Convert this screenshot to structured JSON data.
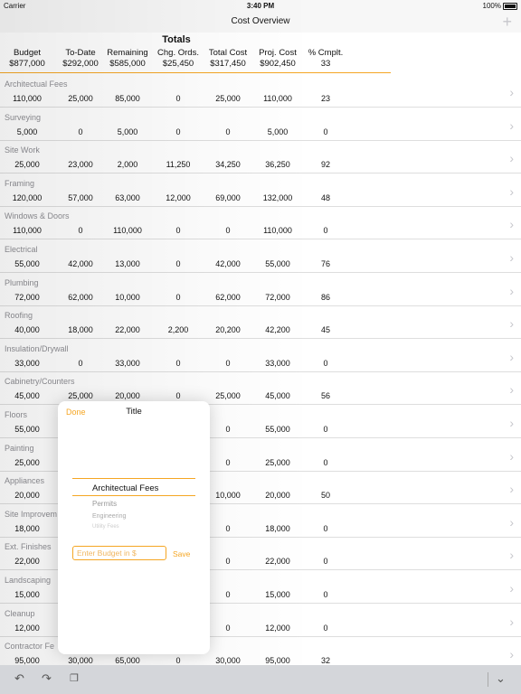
{
  "status_bar": {
    "carrier": "Carrier",
    "time": "3:40 PM",
    "battery": "100%"
  },
  "nav": {
    "title": "Cost Overview"
  },
  "totals": {
    "title": "Totals",
    "columns": [
      {
        "label": "Budget",
        "value": "$877,000"
      },
      {
        "label": "To-Date",
        "value": "$292,000"
      },
      {
        "label": "Remaining",
        "value": "$585,000"
      },
      {
        "label": "Chg. Ords.",
        "value": "$25,450"
      },
      {
        "label": "Total Cost",
        "value": "$317,450"
      },
      {
        "label": "Proj. Cost",
        "value": "$902,450"
      },
      {
        "label": "% Cmplt.",
        "value": "33"
      }
    ]
  },
  "rows": [
    {
      "label": "Architectual  Fees",
      "values": [
        "110,000",
        "25,000",
        "85,000",
        "0",
        "25,000",
        "110,000",
        "23"
      ]
    },
    {
      "label": "Surveying",
      "values": [
        "5,000",
        "0",
        "5,000",
        "0",
        "0",
        "5,000",
        "0"
      ]
    },
    {
      "label": "Site Work",
      "values": [
        "25,000",
        "23,000",
        "2,000",
        "11,250",
        "34,250",
        "36,250",
        "92"
      ]
    },
    {
      "label": "Framing",
      "values": [
        "120,000",
        "57,000",
        "63,000",
        "12,000",
        "69,000",
        "132,000",
        "48"
      ]
    },
    {
      "label": "Windows & Doors",
      "values": [
        "110,000",
        "0",
        "110,000",
        "0",
        "0",
        "110,000",
        "0"
      ]
    },
    {
      "label": "Electrical",
      "values": [
        "55,000",
        "42,000",
        "13,000",
        "0",
        "42,000",
        "55,000",
        "76"
      ]
    },
    {
      "label": "Plumbing",
      "values": [
        "72,000",
        "62,000",
        "10,000",
        "0",
        "62,000",
        "72,000",
        "86"
      ]
    },
    {
      "label": "Roofing",
      "values": [
        "40,000",
        "18,000",
        "22,000",
        "2,200",
        "20,200",
        "42,200",
        "45"
      ]
    },
    {
      "label": "Insulation/Drywall",
      "values": [
        "33,000",
        "0",
        "33,000",
        "0",
        "0",
        "33,000",
        "0"
      ]
    },
    {
      "label": "Cabinetry/Counters",
      "values": [
        "45,000",
        "25,000",
        "20,000",
        "0",
        "25,000",
        "45,000",
        "56"
      ]
    },
    {
      "label": "Floors",
      "values": [
        "55,000",
        "",
        "",
        "",
        "0",
        "55,000",
        "0"
      ]
    },
    {
      "label": "Painting",
      "values": [
        "25,000",
        "",
        "",
        "",
        "0",
        "25,000",
        "0"
      ]
    },
    {
      "label": "Appliances",
      "values": [
        "20,000",
        "",
        "",
        "",
        "10,000",
        "20,000",
        "50"
      ]
    },
    {
      "label": "Site Improvem",
      "values": [
        "18,000",
        "",
        "",
        "",
        "0",
        "18,000",
        "0"
      ]
    },
    {
      "label": "Ext. Finishes",
      "values": [
        "22,000",
        "",
        "",
        "",
        "0",
        "22,000",
        "0"
      ]
    },
    {
      "label": "Landscaping",
      "values": [
        "15,000",
        "",
        "",
        "",
        "0",
        "15,000",
        "0"
      ]
    },
    {
      "label": "Cleanup",
      "values": [
        "12,000",
        "",
        "",
        "",
        "0",
        "12,000",
        "0"
      ]
    },
    {
      "label": "Contractor Fe",
      "values": [
        "95,000",
        "30,000",
        "65,000",
        "0",
        "30,000",
        "95,000",
        "32"
      ]
    }
  ],
  "popover": {
    "done_label": "Done",
    "title": "Title",
    "picker_items": [
      "Architectual  Fees",
      "Permits",
      "Engineering",
      "Utility Fees"
    ],
    "budget_placeholder": "Enter Budget in $",
    "save_label": "Save"
  },
  "colors": {
    "accent": "#f5a623",
    "chevron": "#c7c7cc",
    "toolbar": "#d4d6da"
  },
  "icons": {
    "add": "plus-icon",
    "row": "chevron-right-icon",
    "undo": "undo-icon",
    "redo": "redo-icon",
    "paste": "clipboard-icon",
    "hide_keyboard": "chevron-down-icon"
  }
}
